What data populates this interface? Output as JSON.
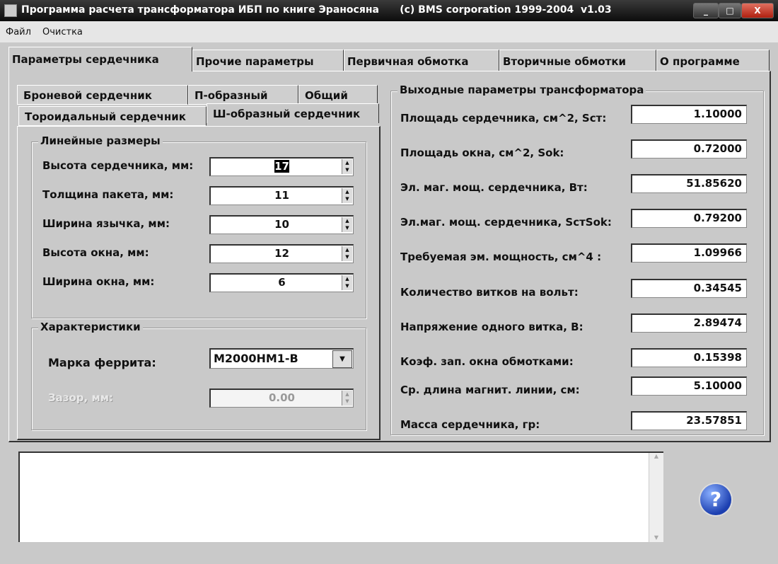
{
  "window": {
    "title": "Программа расчета трансформатора ИБП по книге Эраносяна      (c) BMS corporation 1999-2004  v1.03",
    "minimize": "_",
    "maximize": "□",
    "close": "X"
  },
  "menu": [
    "Файл",
    "Очистка"
  ],
  "tabs": [
    "Параметры сердечника",
    "Прочие параметры",
    "Первичная обмотка",
    "Вторичные обмотки",
    "О программе"
  ],
  "subtabs": {
    "row1": [
      "Броневой сердечник",
      "П-образный",
      "Общий"
    ],
    "row2": [
      "Тороидальный сердечник",
      "Ш-образный сердечник"
    ]
  },
  "linear": {
    "title": "Линейные размеры",
    "rows": [
      {
        "label": "Высота сердечника, мм:",
        "value": "17"
      },
      {
        "label": "Толщина пакета, мм:",
        "value": "11"
      },
      {
        "label": "Ширина язычка, мм:",
        "value": "10"
      },
      {
        "label": "Высота окна, мм:",
        "value": "12"
      },
      {
        "label": "Ширина окна, мм:",
        "value": "6"
      }
    ]
  },
  "characteristics": {
    "title": "Характеристики",
    "ferrite_label": "Марка феррита:",
    "ferrite_value": "M2000HM1-B",
    "gap_label": "Зазор, мм:",
    "gap_value": "0.00"
  },
  "output": {
    "title": "Выходные параметры трансформатора",
    "rows": [
      {
        "label": "Площадь сердечника, см^2, Sст:",
        "value": "1.10000"
      },
      {
        "label": "Площадь окна, см^2, Sok:",
        "value": "0.72000"
      },
      {
        "label": "Эл. маг. мощ. сердечника, Вт:",
        "value": "51.85620"
      },
      {
        "label": "Эл.маг. мощ. сердечника, SстSok:",
        "value": "0.79200"
      },
      {
        "label": "Требуемая эм. мощность, см^4 :",
        "value": "1.09966"
      },
      {
        "label": "Количество витков на вольт:",
        "value": "0.34545"
      },
      {
        "label": "Напряжение одного витка, В:",
        "value": "2.89474"
      },
      {
        "label": "Коэф. зап. окна обмотками:",
        "value": "0.15398"
      },
      {
        "label": "Ср. длина магнит. линии, см:",
        "value": "5.10000"
      },
      {
        "label": "Масса сердечника, гр:",
        "value": "23.57851"
      }
    ]
  },
  "help": "?"
}
